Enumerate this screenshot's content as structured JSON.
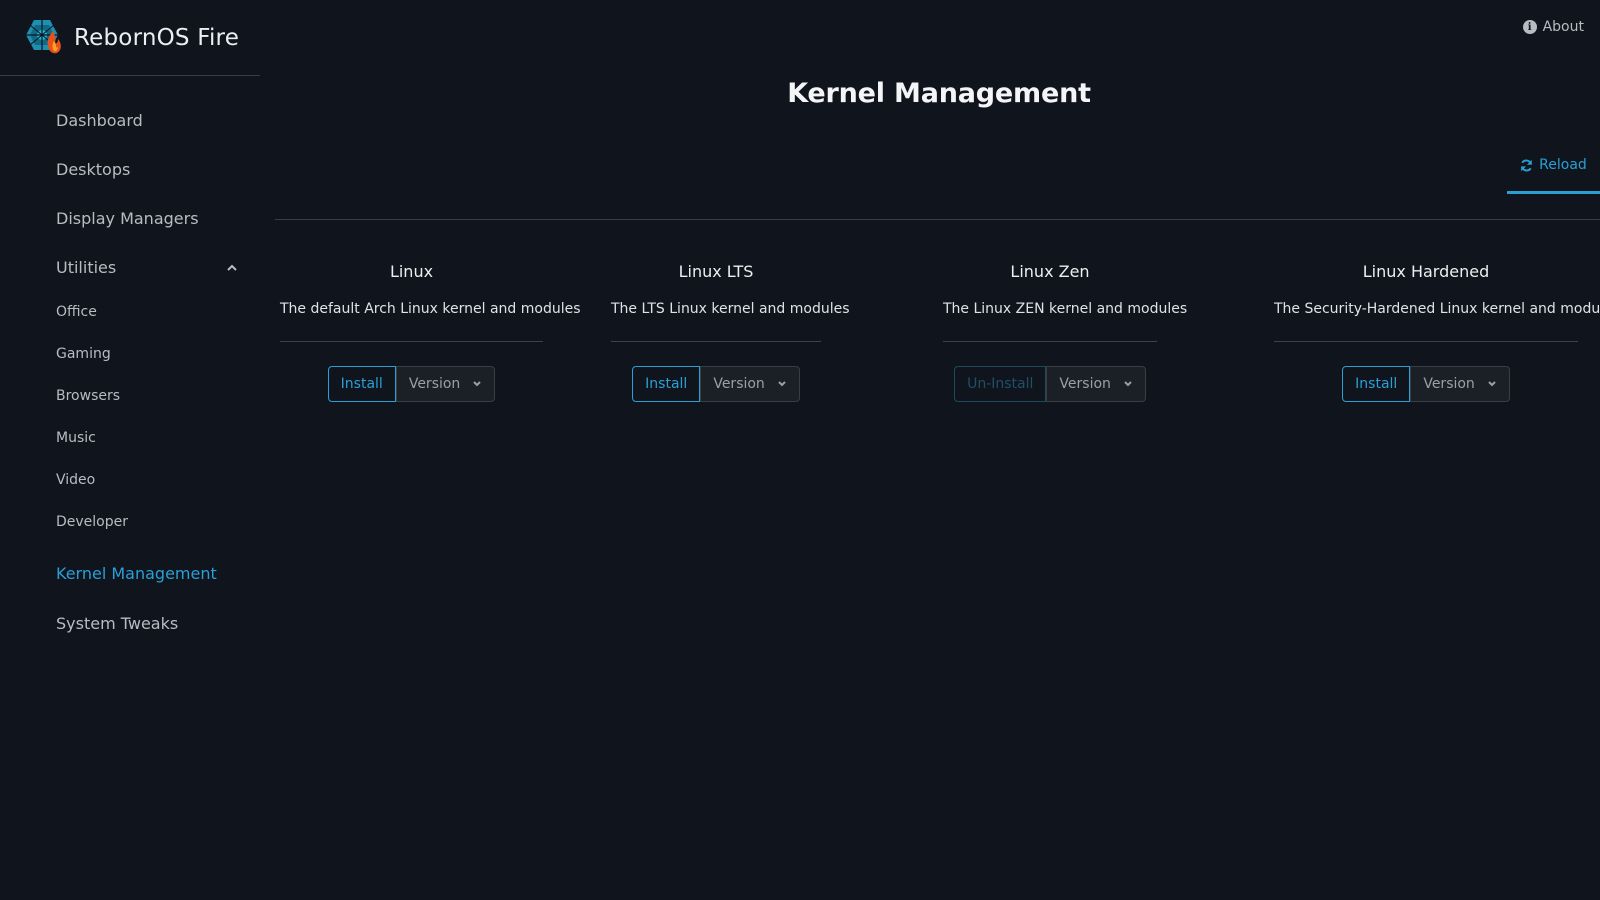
{
  "app": {
    "title": "RebornOS Fire"
  },
  "header": {
    "about_label": "About",
    "page_title": "Kernel Management"
  },
  "sidebar": {
    "items": [
      {
        "label": "Dashboard"
      },
      {
        "label": "Desktops"
      },
      {
        "label": "Display Managers"
      },
      {
        "label": "Utilities",
        "expanded": true
      },
      {
        "label": "Office"
      },
      {
        "label": "Gaming"
      },
      {
        "label": "Browsers"
      },
      {
        "label": "Music"
      },
      {
        "label": "Video"
      },
      {
        "label": "Developer"
      },
      {
        "label": "Kernel Management",
        "active": true
      },
      {
        "label": "System Tweaks"
      }
    ]
  },
  "tabs": {
    "reload_label": "Reload"
  },
  "kernels": [
    {
      "name": "Linux",
      "description": "The default Arch Linux kernel and modules",
      "action": "Install",
      "installed": false,
      "version_label": "Version"
    },
    {
      "name": "Linux LTS",
      "description": "The LTS Linux kernel and modules",
      "action": "Install",
      "installed": false,
      "version_label": "Version"
    },
    {
      "name": "Linux Zen",
      "description": "The Linux ZEN kernel and modules",
      "action": "Un-Install",
      "installed": true,
      "version_label": "Version"
    },
    {
      "name": "Linux Hardened",
      "description": "The Security-Hardened Linux kernel and modules",
      "action": "Install",
      "installed": false,
      "version_label": "Version"
    }
  ],
  "colors": {
    "accent": "#2a9fd6",
    "background": "#10141c",
    "disabled_action": "#1f5068"
  }
}
